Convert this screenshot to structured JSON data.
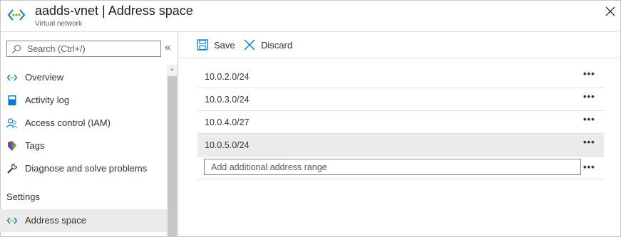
{
  "header": {
    "title": "aadds-vnet | Address space",
    "subtitle": "Virtual network",
    "icon": "virtual-network-icon",
    "close_icon": "close-icon"
  },
  "sidebar": {
    "search": {
      "placeholder": "Search (Ctrl+/)",
      "value": ""
    },
    "collapse_glyph": "«",
    "items": [
      {
        "label": "Overview",
        "icon": "overview-icon"
      },
      {
        "label": "Activity log",
        "icon": "activity-log-icon"
      },
      {
        "label": "Access control (IAM)",
        "icon": "people-icon"
      },
      {
        "label": "Tags",
        "icon": "tag-icon"
      },
      {
        "label": "Diagnose and solve problems",
        "icon": "wrench-icon"
      }
    ],
    "section_settings": "Settings",
    "settings_items": [
      {
        "label": "Address space",
        "icon": "address-space-icon",
        "active": true
      }
    ]
  },
  "toolbar": {
    "save_label": "Save",
    "discard_label": "Discard"
  },
  "address_ranges": [
    {
      "value": "10.0.2.0/24",
      "selected": false
    },
    {
      "value": "10.0.3.0/24",
      "selected": false
    },
    {
      "value": "10.0.4.0/27",
      "selected": false
    },
    {
      "value": "10.0.5.0/24",
      "selected": true
    }
  ],
  "add_range": {
    "placeholder": "Add additional address range",
    "value": ""
  },
  "more_glyph": "•••",
  "colors": {
    "accent": "#0078d4",
    "selected_bg": "#edebe9",
    "border": "#c8c6c4"
  }
}
